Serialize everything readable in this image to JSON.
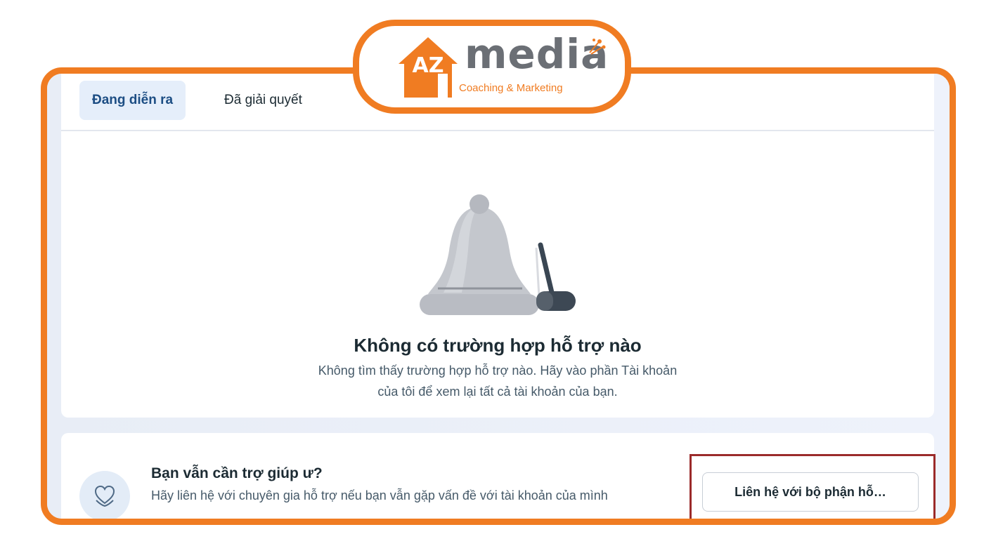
{
  "tabs": [
    {
      "label": "Đang diễn ra",
      "active": true
    },
    {
      "label": "Đã giải quyết",
      "active": false
    }
  ],
  "empty_state": {
    "icon": "bell-icon",
    "title": "Không có trường hợp hỗ trợ nào",
    "desc_line1": "Không tìm thấy trường hợp hỗ trợ nào. Hãy vào phần Tài khoản",
    "desc_line2": "của tôi để xem lại tất cả tài khoản của bạn."
  },
  "help": {
    "icon": "heart-hands-icon",
    "title": "Bạn vẫn cần trợ giúp ư?",
    "desc": "Hãy liên hệ với chuyên gia hỗ trợ nếu bạn vẫn gặp vấn đề với tài khoản của mình",
    "button_label": "Liên hệ với bộ phận hỗ…"
  },
  "logo": {
    "az_text": "AZ",
    "brand": "media",
    "tagline": "Coaching & Marketing"
  },
  "colors": {
    "frame_accent": "#f07c22",
    "highlight_border": "#9b2a2a",
    "active_tab_bg": "#e5eefa",
    "active_tab_text": "#1d4e84"
  }
}
